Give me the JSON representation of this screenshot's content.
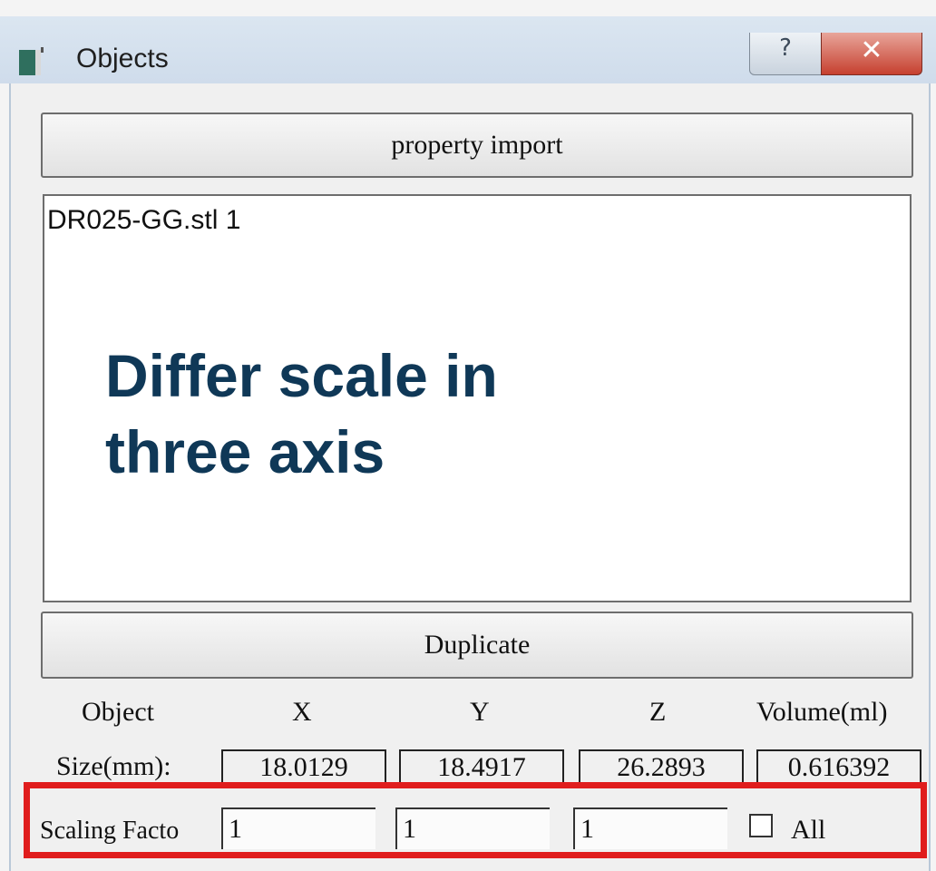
{
  "window": {
    "title": "Objects",
    "help_symbol": "?",
    "close_symbol": "✕"
  },
  "buttons": {
    "property_import": "property import",
    "duplicate": "Duplicate"
  },
  "list": {
    "items": [
      "DR025-GG.stl 1"
    ]
  },
  "overlay": {
    "line1": "Differ scale in",
    "line2": "three axis"
  },
  "table": {
    "headers": [
      "Object",
      "X",
      "Y",
      "Z",
      "Volume(ml)"
    ],
    "size_label": "Size(mm):",
    "size_values": [
      "18.0129",
      "18.4917",
      "26.2893",
      "0.616392"
    ]
  },
  "scaling": {
    "label": "Scaling Facto",
    "x": "1",
    "y": "1",
    "z": "1",
    "all_label": "All",
    "all_checked": false
  },
  "colors": {
    "highlight": "#e01d1d",
    "overlay_text": "#0f3857"
  }
}
